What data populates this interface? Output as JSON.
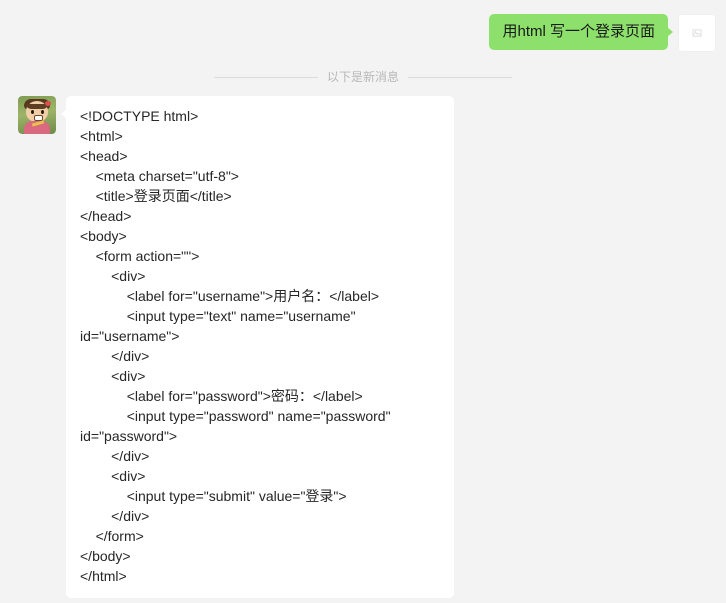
{
  "theme": {
    "page_background": "#f3f3f3",
    "outgoing_bubble_color": "#8ce06b",
    "incoming_bubble_color": "#ffffff",
    "code_text_color": "#262626",
    "divider_color": "#dcdcdc",
    "divider_text_color": "#b8b8b8"
  },
  "messages": {
    "outgoing": {
      "text": "用html 写一个登录页面",
      "avatar_icon": "broken-image-icon"
    },
    "divider": {
      "label": "以下是新消息"
    },
    "incoming": {
      "avatar_icon": "user-avatar-photo",
      "code": "<!DOCTYPE html>\n<html>\n<head>\n    <meta charset=\"utf-8\">\n    <title>登录页面</title>\n</head>\n<body>\n    <form action=\"\">\n        <div>\n            <label for=\"username\">用户名：</label>\n            <input type=\"text\" name=\"username\" id=\"username\">\n        </div>\n        <div>\n            <label for=\"password\">密码：</label>\n            <input type=\"password\" name=\"password\" id=\"password\">\n        </div>\n        <div>\n            <input type=\"submit\" value=\"登录\">\n        </div>\n    </form>\n</body>\n</html>"
    }
  }
}
